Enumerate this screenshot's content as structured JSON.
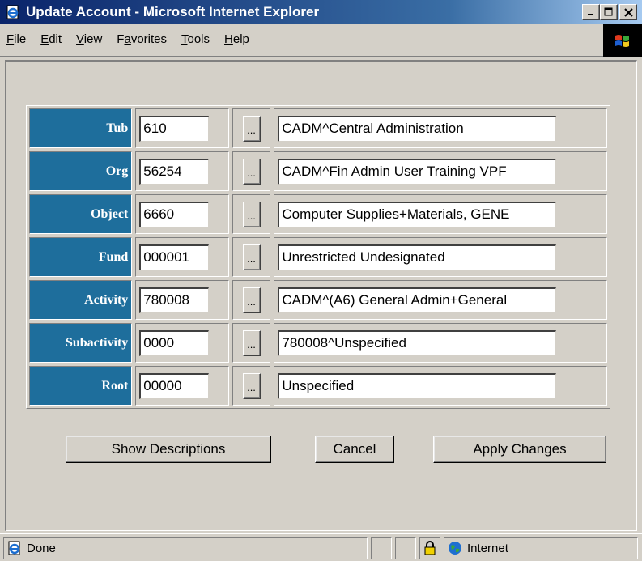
{
  "window": {
    "title": "Update Account - Microsoft Internet Explorer",
    "icon": "ie-page-icon"
  },
  "menu": {
    "items": [
      {
        "label": "File",
        "underline": "F"
      },
      {
        "label": "Edit",
        "underline": "E"
      },
      {
        "label": "View",
        "underline": "V"
      },
      {
        "label": "Favorites",
        "underline": "a"
      },
      {
        "label": "Tools",
        "underline": "T"
      },
      {
        "label": "Help",
        "underline": "H"
      }
    ]
  },
  "fields": [
    {
      "label": "Tub",
      "code": "610",
      "button": "...",
      "description": "CADM^Central Administration"
    },
    {
      "label": "Org",
      "code": "56254",
      "button": "...",
      "description": "CADM^Fin Admin User Training VPF"
    },
    {
      "label": "Object",
      "code": "6660",
      "button": "...",
      "description": "Computer Supplies+Materials, GENE"
    },
    {
      "label": "Fund",
      "code": "000001",
      "button": "...",
      "description": "Unrestricted Undesignated"
    },
    {
      "label": "Activity",
      "code": "780008",
      "button": "...",
      "description": "CADM^(A6) General Admin+General"
    },
    {
      "label": "Subactivity",
      "code": "0000",
      "button": "...",
      "description": "780008^Unspecified"
    },
    {
      "label": "Root",
      "code": "00000",
      "button": "...",
      "description": "Unspecified"
    }
  ],
  "buttons": {
    "show_descriptions": "Show Descriptions",
    "cancel": "Cancel",
    "apply_changes": "Apply Changes"
  },
  "status": {
    "text": "Done",
    "zone": "Internet"
  },
  "colors": {
    "label_bg": "#1e6e9c",
    "titlebar_start": "#0a246a",
    "titlebar_end": "#a6caf0",
    "chrome": "#d4d0c8"
  }
}
